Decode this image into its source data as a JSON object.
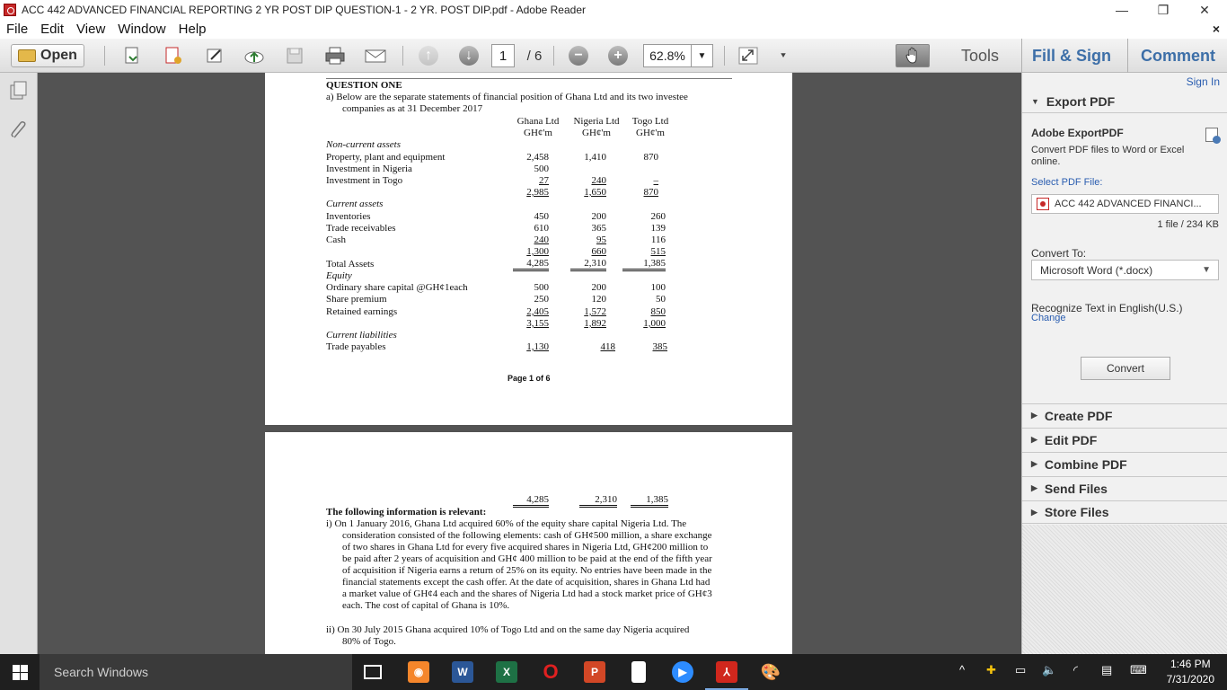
{
  "window": {
    "title": "ACC 442 ADVANCED FINANCIAL REPORTING 2 YR POST DIP QUESTION-1 - 2 YR. POST DIP.pdf - Adobe Reader",
    "minimize": "—",
    "restore": "❐",
    "close": "✕"
  },
  "menu": {
    "items": [
      "File",
      "Edit",
      "View",
      "Window",
      "Help"
    ],
    "close": "×"
  },
  "toolbar": {
    "open_label": "Open",
    "page_current": "1",
    "page_total": "/ 6",
    "zoom_minus": "−",
    "zoom_plus": "+",
    "zoom_value": "62.8%",
    "dropdown_caret": "▼",
    "tools_label": "Tools",
    "fill_sign_label": "Fill & Sign",
    "comment_label": "Comment"
  },
  "page1": {
    "heading": "QUESTION ONE",
    "intro_line1": "a)  Below are the separate statements of financial position of Ghana Ltd and its two investee",
    "intro_line2": "companies as at 31 December 2017",
    "col_heads": [
      {
        "name": "Ghana Ltd",
        "unit": "GH¢'m"
      },
      {
        "name": "Nigeria Ltd",
        "unit": "GH¢'m"
      },
      {
        "name": "Togo Ltd",
        "unit": "GH¢'m"
      }
    ],
    "section_nca": "Non-current assets",
    "row_ppe": {
      "label": "Property, plant and equipment",
      "v": [
        "2,458",
        "1,410",
        "870"
      ]
    },
    "row_inv_nigeria": {
      "label": "Investment in Nigeria",
      "v": [
        "500",
        "",
        ""
      ]
    },
    "row_inv_togo": {
      "label": "Investment in Togo",
      "v": [
        "27",
        "240",
        "–"
      ]
    },
    "total_nca": [
      "2,985",
      "1,650",
      "870"
    ],
    "section_ca": "Current assets",
    "row_inventories": {
      "label": "Inventories",
      "v": [
        "450",
        "200",
        "260"
      ]
    },
    "row_receivables": {
      "label": "Trade receivables",
      "v": [
        "610",
        "365",
        "139"
      ]
    },
    "row_cash": {
      "label": "Cash",
      "v": [
        "240",
        "95",
        "116"
      ]
    },
    "total_ca": [
      "1,300",
      "660",
      "515"
    ],
    "row_total_assets": {
      "label": "Total Assets",
      "v": [
        "4,285",
        "2,310",
        "1,385"
      ]
    },
    "section_equity": "Equity",
    "row_share_capital": {
      "label": "Ordinary share capital @GH¢1each",
      "v": [
        "500",
        "200",
        "100"
      ]
    },
    "row_share_premium": {
      "label": "Share premium",
      "v": [
        "250",
        "120",
        "50"
      ]
    },
    "row_retained": {
      "label": "Retained earnings",
      "v": [
        "2,405",
        "1,572",
        "850"
      ]
    },
    "total_equity": [
      "3,155",
      "1,892",
      "1,000"
    ],
    "section_cl": "Current liabilities",
    "row_payables": {
      "label": "Trade payables",
      "v": [
        "1,130",
        "418",
        "385"
      ]
    },
    "footer": "Page 1 of 6"
  },
  "page2": {
    "totals": [
      "4,285",
      "2,310",
      "1,385"
    ],
    "heading": "The following information is relevant:",
    "para_i": [
      "i)   On 1 January 2016, Ghana Ltd acquired 60% of the equity share capital Nigeria Ltd. The",
      "consideration consisted of the following elements: cash of GH¢500 million, a share exchange",
      "of two shares in Ghana Ltd for every five acquired shares in Nigeria Ltd, GH¢200 million to",
      "be paid after 2 years of acquisition and GH¢ 400 million to be paid at the end of the fifth year",
      "of acquisition if Nigeria earns a return of 25% on its equity. No entries have been made in the",
      "financial statements except the cash offer. At the date of acquisition, shares in Ghana Ltd had",
      "a market value of GH¢4 each and the shares of Nigeria Ltd had a stock market price of GH¢3",
      "each.  The cost of capital of Ghana is 10%."
    ],
    "para_ii": [
      "ii)  On 30 July 2015 Ghana acquired 10% of Togo Ltd and on the same day Nigeria acquired",
      "80% of Togo."
    ]
  },
  "panel": {
    "sign_in": "Sign In",
    "export_head": "Export PDF",
    "service_title": "Adobe ExportPDF",
    "service_desc1": "Convert PDF files to Word or Excel",
    "service_desc2": "online.",
    "select_label": "Select PDF File:",
    "file_name": "ACC 442 ADVANCED FINANCI...",
    "file_count": "1 file / 234 KB",
    "convert_to_label": "Convert To:",
    "convert_to_value": "Microsoft Word (*.docx)",
    "recognize_text": "Recognize Text in English(U.S.)",
    "change_link": "Change",
    "convert_button": "Convert",
    "sections": [
      "Create PDF",
      "Edit PDF",
      "Combine PDF",
      "Send Files",
      "Store Files"
    ]
  },
  "taskbar": {
    "search_placeholder": "Search Windows",
    "time": "1:46 PM",
    "date": "7/31/2020"
  }
}
